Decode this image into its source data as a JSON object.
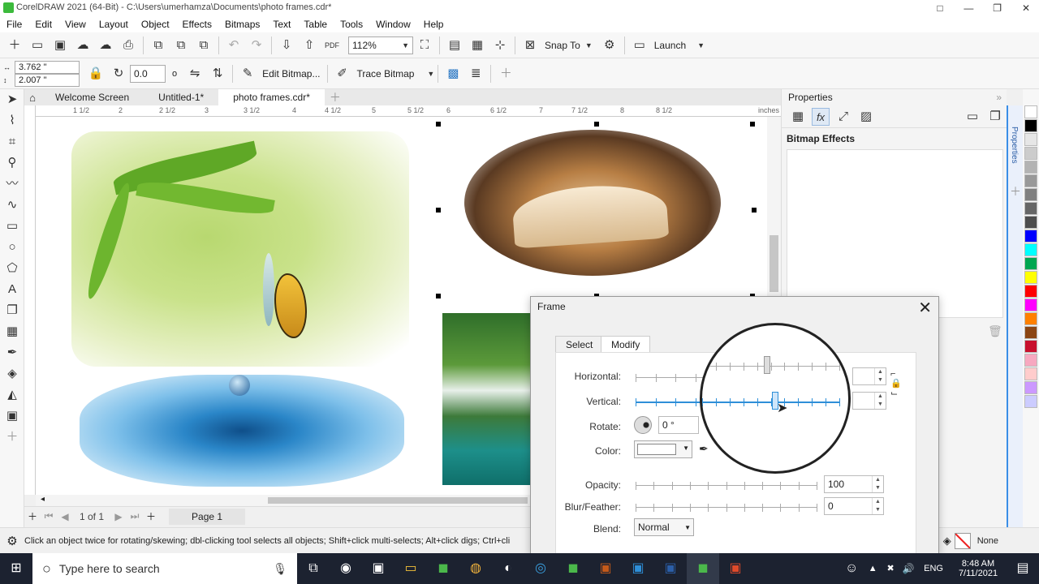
{
  "window": {
    "title": "CorelDRAW 2021 (64-Bit) - C:\\Users\\umerhamza\\Documents\\photo frames.cdr*",
    "controls": [
      "□",
      "—",
      "❐",
      "✕"
    ]
  },
  "menu": [
    "File",
    "Edit",
    "View",
    "Layout",
    "Object",
    "Effects",
    "Bitmaps",
    "Text",
    "Table",
    "Tools",
    "Window",
    "Help"
  ],
  "toolbar1": {
    "zoom": "112%",
    "snap_to": "Snap To",
    "launch": "Launch"
  },
  "toolbar2": {
    "x_value": "3.762 \"",
    "y_value": "2.007 \"",
    "rotation": "0.0",
    "degree": "o",
    "edit_bitmap": "Edit Bitmap...",
    "trace_bitmap": "Trace Bitmap"
  },
  "doc_tabs": [
    "Welcome Screen",
    "Untitled-1*",
    "photo frames.cdr*"
  ],
  "ruler": {
    "h_labels": [
      "1 1/2",
      "2",
      "2 1/2",
      "3",
      "3 1/2",
      "4",
      "4 1/2",
      "5",
      "5 1/2",
      "6",
      "6 1/2",
      "7",
      "7 1/2",
      "8",
      "8 1/2"
    ],
    "unit": "inches"
  },
  "properties": {
    "title": "Properties",
    "section": "Bitmap Effects",
    "side_tab": "Properties"
  },
  "pagebar": {
    "page_count": "1  of  1",
    "page_tab": "Page 1"
  },
  "status": {
    "hint": "Click an object twice for rotating/skewing; dbl-clicking tool selects all objects; Shift+click multi-selects; Alt+click digs; Ctrl+cli",
    "fill": "None"
  },
  "frame_dialog": {
    "title": "Frame",
    "tabs": [
      "Select",
      "Modify"
    ],
    "horizontal_label": "Horizontal:",
    "vertical_label": "Vertical:",
    "rotate_label": "Rotate:",
    "rotate_value": "0 °",
    "color_label": "Color:",
    "opacity_label": "Opacity:",
    "opacity_value": "100",
    "blur_label": "Blur/Feather:",
    "blur_value": "0",
    "blend_label": "Blend:",
    "blend_value": "Normal"
  },
  "palette": [
    "#ffffff",
    "#000000",
    "#e6e6e6",
    "#cccccc",
    "#b3b3b3",
    "#999999",
    "#808080",
    "#666666",
    "#4d4d4d",
    "#0000ff",
    "#00ffff",
    "#00a651",
    "#ffff00",
    "#ff0000",
    "#ff00ff",
    "#ff8000",
    "#8b4513",
    "#c8102e",
    "#f7a8c0",
    "#ffcccc",
    "#cc99ff",
    "#ccccff"
  ],
  "taskbar": {
    "search_placeholder": "Type here to search",
    "language": "ENG",
    "time": "8:48 AM",
    "date": "7/11/2021"
  }
}
